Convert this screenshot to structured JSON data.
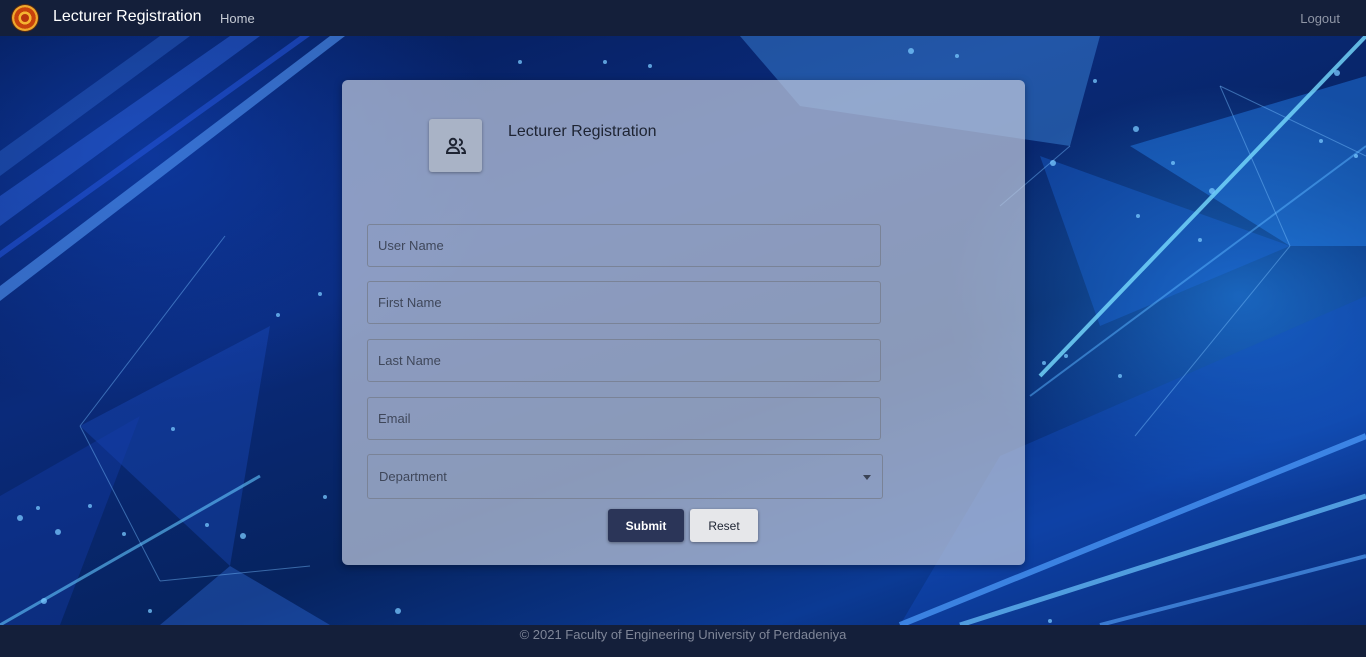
{
  "navbar": {
    "logo_icon": "university-crest-icon",
    "brand": "Lecturer Registration",
    "home": "Home",
    "logout": "Logout"
  },
  "card": {
    "icon": "people-icon",
    "title": "Lecturer Registration",
    "fields": {
      "username_placeholder": "User Name",
      "firstname_placeholder": "First Name",
      "lastname_placeholder": "Last Name",
      "email_placeholder": "Email"
    },
    "department_label": "Department",
    "submit": "Submit",
    "reset": "Reset"
  },
  "footer": {
    "text": "© 2021 Faculty of Engineering University of Perdadeniya"
  },
  "colors": {
    "navbar": "#141f3a",
    "submit_button": "#2b3558",
    "reset_button": "#e6e7ea"
  }
}
